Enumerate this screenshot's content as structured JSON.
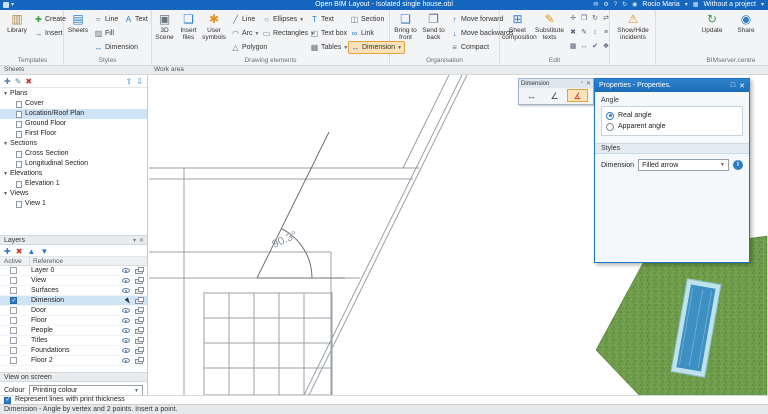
{
  "titlebar": {
    "title": "Open BIM Layout - Isolated single house.obl",
    "user": "Rocio Maria",
    "project": "Without a project"
  },
  "ribbon": {
    "templates": {
      "group_label": "Templates",
      "library": "Library",
      "create": "Create",
      "insert": "Insert"
    },
    "styles": {
      "group_label": "Styles",
      "sheets": "Sheets",
      "line": "Line",
      "text": "Text",
      "fill": "Fill",
      "dimension": "Dimension"
    },
    "drawing": {
      "group_label": "Drawing elements",
      "scene3d": "3D Scene",
      "insert_files": "Insert files",
      "user_symbols": "User symbols",
      "line": "Line",
      "arc": "Arc",
      "polygon": "Polygon",
      "ellipses": "Ellipses",
      "rectangles": "Rectangles",
      "text": "Text",
      "text_box": "Text box",
      "tables": "Tables",
      "section": "Section",
      "link": "Link",
      "dimension": "Dimension"
    },
    "organisation": {
      "group_label": "Organisation",
      "bring_to_front": "Bring to front",
      "send_to_back": "Send to back",
      "move_forward": "Move forward",
      "move_backwards": "Move backwards",
      "compact": "Compact"
    },
    "edit": {
      "group_label": "Edit",
      "sheet_composition": "Sheet composition",
      "substitute_texts": "Substitute texts"
    },
    "incidents_label": "Show/Hide incidents",
    "bimserver": {
      "group_label": "BIMserver.centre",
      "update": "Update",
      "share": "Share"
    }
  },
  "panel_bar": {
    "sheets": "Sheets",
    "work_area": "Work area"
  },
  "sheets_tree": {
    "groups": [
      {
        "label": "Plans",
        "children": [
          "Cover",
          "Location/Roof Plan",
          "Ground Floor",
          "First Floor"
        ]
      },
      {
        "label": "Sections",
        "children": [
          "Cross Section",
          "Longitudinal Section"
        ]
      },
      {
        "label": "Elevations",
        "children": [
          "Elevation 1"
        ]
      },
      {
        "label": "Views",
        "children": [
          "View 1"
        ]
      }
    ],
    "selected": "Location/Roof Plan"
  },
  "layers": {
    "title": "Layers",
    "columns": {
      "active": "Active",
      "reference": "Reference"
    },
    "rows": [
      {
        "name": "Layer 0",
        "checked": false
      },
      {
        "name": "View",
        "checked": false
      },
      {
        "name": "Surfaces",
        "checked": false
      },
      {
        "name": "Dimension",
        "checked": true
      },
      {
        "name": "Door",
        "checked": false
      },
      {
        "name": "Floor",
        "checked": false
      },
      {
        "name": "People",
        "checked": false
      },
      {
        "name": "Titles",
        "checked": false
      },
      {
        "name": "Foundations",
        "checked": false
      },
      {
        "name": "Floor 2",
        "checked": false
      }
    ]
  },
  "view_on_screen": {
    "title": "View on screen",
    "colour_label": "Colour",
    "colour_value": "Printing colour"
  },
  "statusbar": {
    "represent": "Represent lines with print thickness",
    "hint": "Dimension - Angle by vertex and 2 points. Insert a point."
  },
  "canvas": {
    "angle_text": "90.3°"
  },
  "dimension_toolbar": {
    "title": "Dimension"
  },
  "properties": {
    "title": "Properties - Properties.",
    "angle_label": "Angle",
    "real_angle": "Real angle",
    "apparent_angle": "Apparent angle",
    "styles_label": "Styles",
    "dimension_label": "Dimension",
    "dimension_value": "Filled arrow"
  },
  "colors": {
    "accent_blue": "#2f7cc6",
    "titlebar": "#1467bd",
    "active_tool": "#fbe2b8",
    "grass": "#6f9c4b",
    "pool_water": "#3e90c2"
  },
  "icons": {
    "library": "▥",
    "create": "✚",
    "insert": "→",
    "sheets": "▤",
    "line_style": "≈",
    "text_style": "A",
    "fill": "▨",
    "dimension_style": "↔",
    "scene3d": "▣",
    "insert_files": "❏",
    "user_symbols": "✱",
    "line": "╱",
    "arc": "◠",
    "polygon": "△",
    "ellipses": "○",
    "rectangles": "▭",
    "text": "T",
    "text_box": "◰",
    "tables": "▦",
    "section": "◫",
    "link": "∞",
    "dimension": "↔",
    "bring_to_front": "❏",
    "send_to_back": "❐",
    "move_forward": "↑",
    "move_backwards": "↓",
    "compact": "≡",
    "sheet_composition": "⊞",
    "substitute_texts": "✎",
    "warning": "⚠",
    "update": "↻",
    "share": "◉",
    "mini_linear": "↔",
    "mini_angle": "∠",
    "mini_angle_vertex": "∡",
    "edit_tools": [
      "✛",
      "❐",
      "↻",
      "⇄",
      "✖",
      "✎",
      "↕",
      "≡",
      "▦",
      "↔",
      "✔",
      "❖"
    ]
  }
}
